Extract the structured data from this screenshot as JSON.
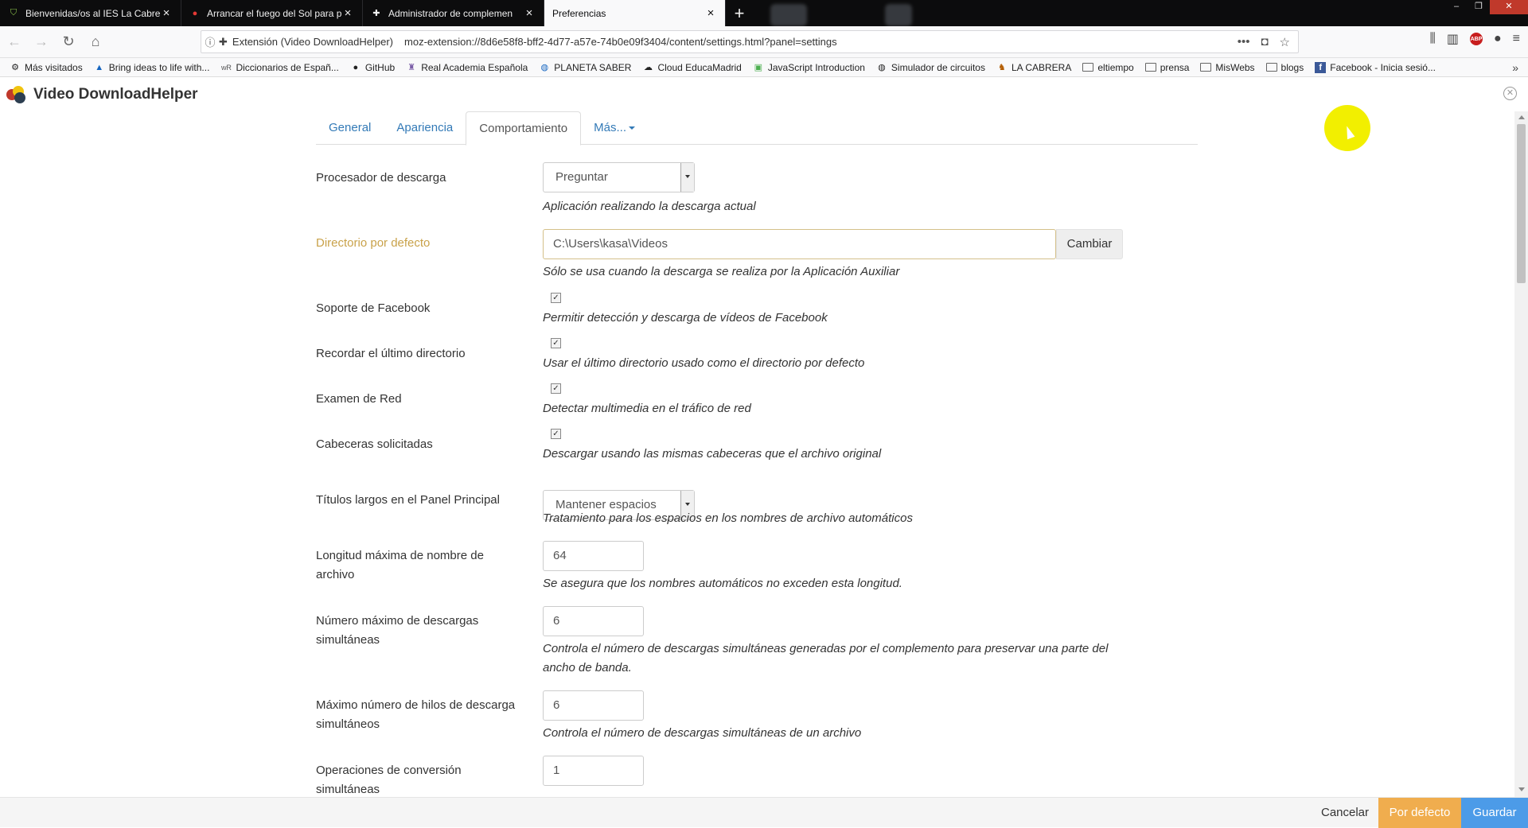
{
  "browser": {
    "tabs": [
      {
        "title": "Bienvenidas/os al IES La Cabrera",
        "icon": "shield-icon",
        "active": false
      },
      {
        "title": "Arrancar el fuego del Sol para p",
        "icon": "fire-icon",
        "active": false
      },
      {
        "title": "Administrador de complemen",
        "icon": "puzzle-icon",
        "active": false
      },
      {
        "title": "Preferencias",
        "icon": "",
        "active": true
      }
    ],
    "url_extension_label": "Extensión (Video DownloadHelper)",
    "url": "moz-extension://8d6e58f8-bff2-4d77-a57e-74b0e09f3404/content/settings.html?panel=settings",
    "bookmarks": [
      {
        "label": "Más visitados",
        "icon": "gear-icon"
      },
      {
        "label": "Bring ideas to life with...",
        "icon": "triangle-icon"
      },
      {
        "label": "Diccionarios de Españ...",
        "icon": "wr-icon"
      },
      {
        "label": "GitHub",
        "icon": "github-icon"
      },
      {
        "label": "Real Academia Española",
        "icon": "crest-icon"
      },
      {
        "label": "PLANETA SABER",
        "icon": "globe-icon"
      },
      {
        "label": "Cloud EducaMadrid",
        "icon": "cloud-icon"
      },
      {
        "label": "JavaScript Introduction",
        "icon": "w3-icon"
      },
      {
        "label": "Simulador de circuitos",
        "icon": "globe-icon"
      },
      {
        "label": "LA CABRERA",
        "icon": "goat-icon"
      },
      {
        "label": "eltiempo",
        "icon": "folder-icon"
      },
      {
        "label": "prensa",
        "icon": "folder-icon"
      },
      {
        "label": "MisWebs",
        "icon": "folder-icon"
      },
      {
        "label": "blogs",
        "icon": "folder-icon"
      },
      {
        "label": "Facebook - Inicia sesió...",
        "icon": "facebook-icon"
      }
    ]
  },
  "app": {
    "title": "Video DownloadHelper"
  },
  "tabs": {
    "general": "General",
    "apariencia": "Apariencia",
    "comportamiento": "Comportamiento",
    "mas": "Más..."
  },
  "settings": {
    "processor": {
      "label": "Procesador de descarga",
      "value": "Preguntar",
      "help": "Aplicación realizando la descarga actual"
    },
    "directory": {
      "label": "Directorio por defecto",
      "value": "C:\\Users\\kasa\\Videos",
      "button": "Cambiar",
      "help": "Sólo se usa cuando la descarga se realiza por la Aplicación Auxiliar"
    },
    "facebook": {
      "label": "Soporte de Facebook",
      "checked": true,
      "help": "Permitir detección y descarga de vídeos de Facebook"
    },
    "remember_dir": {
      "label": "Recordar el último directorio",
      "checked": true,
      "help": "Usar el último directorio usado como el directorio por defecto"
    },
    "network": {
      "label": "Examen de Red",
      "checked": true,
      "help": "Detectar multimedia en el tráfico de red"
    },
    "headers": {
      "label": "Cabeceras solicitadas",
      "checked": true,
      "help": "Descargar usando las mismas cabeceras que el archivo original"
    },
    "long_titles": {
      "label": "Títulos largos en el Panel Principal",
      "value": "Mantener espacios",
      "help": "Tratamiento para los espacios en los nombres de archivo automáticos"
    },
    "max_filename": {
      "label": "Longitud máxima de nombre de archivo",
      "value": "64",
      "help": "Se asegura que los nombres automáticos no exceden esta longitud."
    },
    "max_downloads": {
      "label": "Número máximo de descargas simultáneas",
      "value": "6",
      "help": "Controla el número de descargas simultáneas generadas por el complemento para preservar una parte del ancho de banda."
    },
    "max_threads": {
      "label": "Máximo número de hilos de descarga simultáneos",
      "value": "6",
      "help": "Controla el número de descargas simultáneas de un archivo"
    },
    "conversions": {
      "label": "Operaciones de conversión simultáneas",
      "value": "1"
    }
  },
  "footer": {
    "cancel": "Cancelar",
    "default": "Por defecto",
    "save": "Guardar"
  },
  "colors": {
    "accent_link": "#337ab7",
    "warn_label": "#c9a24a",
    "btn_default": "#f0ad4e",
    "btn_save": "#4c9be8"
  }
}
